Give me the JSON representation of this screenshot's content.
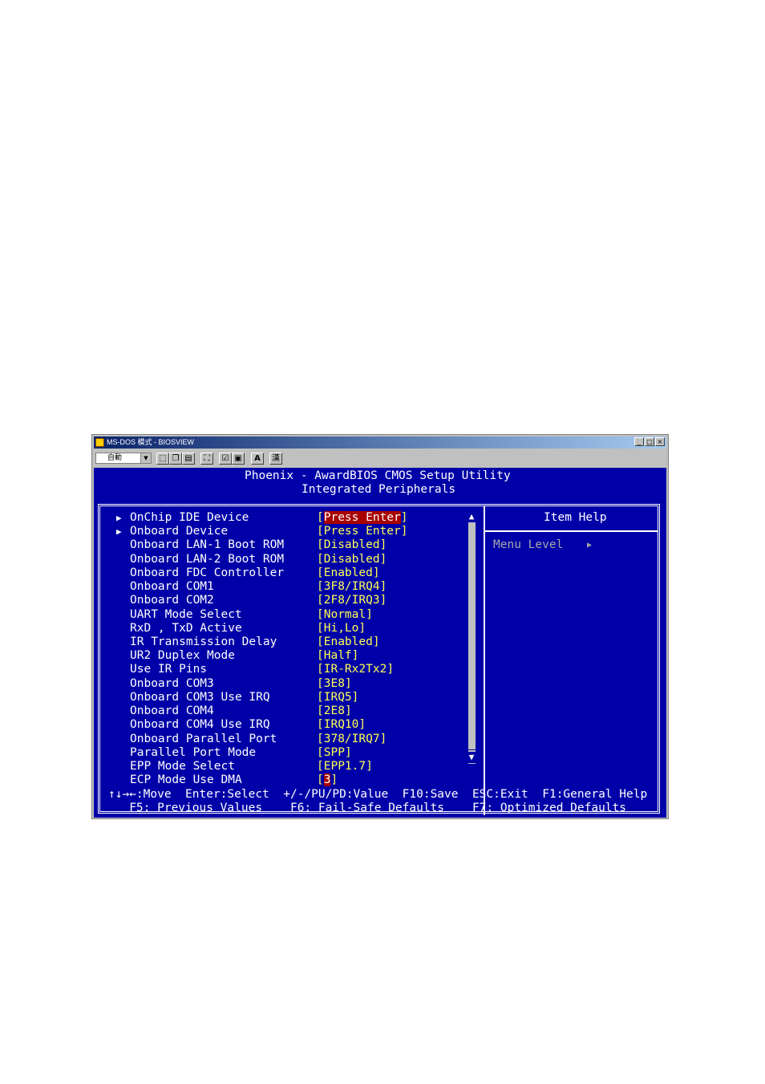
{
  "window": {
    "title": "MS-DOS 模式 - BIOSVIEW",
    "font_select": "自動",
    "controls": [
      "_",
      "□",
      "×"
    ]
  },
  "toolbar_icons": [
    "mark-icon",
    "copy-icon",
    "paste-icon",
    "fullscreen-icon",
    "properties-icon",
    "background-icon",
    "font-icon",
    "ime-icon"
  ],
  "toolbar_glyphs": {
    "font": "A",
    "ime": "漢"
  },
  "header": {
    "line1": "Phoenix - AwardBIOS CMOS Setup Utility",
    "line2": "Integrated Peripherals"
  },
  "items": [
    {
      "label": "OnChip IDE Device",
      "value": "Press Enter",
      "submenu": true,
      "highlight": true
    },
    {
      "label": "Onboard Device",
      "value": "Press Enter",
      "submenu": true
    },
    {
      "label": "Onboard LAN-1 Boot ROM",
      "value": "Disabled"
    },
    {
      "label": "Onboard LAN-2 Boot ROM",
      "value": "Disabled"
    },
    {
      "label": "Onboard FDC Controller",
      "value": "Enabled"
    },
    {
      "label": "Onboard COM1",
      "value": "3F8/IRQ4"
    },
    {
      "label": "Onboard COM2",
      "value": "2F8/IRQ3"
    },
    {
      "label": "UART Mode Select",
      "value": "Normal"
    },
    {
      "label": "RxD , TxD Active",
      "value": "Hi,Lo"
    },
    {
      "label": "IR Transmission Delay",
      "value": "Enabled"
    },
    {
      "label": "UR2 Duplex Mode",
      "value": "Half"
    },
    {
      "label": "Use IR Pins",
      "value": "IR-Rx2Tx2"
    },
    {
      "label": "Onboard COM3",
      "value": "3E8"
    },
    {
      "label": "Onboard COM3 Use IRQ",
      "value": "IRQ5"
    },
    {
      "label": "Onboard COM4",
      "value": "2E8"
    },
    {
      "label": "Onboard COM4 Use IRQ",
      "value": "IRQ10"
    },
    {
      "label": "Onboard Parallel Port",
      "value": "378/IRQ7"
    },
    {
      "label": "Parallel Port Mode",
      "value": "SPP"
    },
    {
      "label": "EPP Mode Select",
      "value": "EPP1.7"
    },
    {
      "label": "ECP Mode Use DMA",
      "value": "3",
      "highlight": true
    }
  ],
  "submenu_glyph": "▶",
  "scroll": {
    "up": "▲",
    "down": "▼"
  },
  "help": {
    "title": "Item Help",
    "menu_level": "Menu Level",
    "menu_level_arrow": "▶"
  },
  "keys": {
    "line1": "↑↓→←:Move  Enter:Select  +/-/PU/PD:Value  F10:Save  ESC:Exit  F1:General Help",
    "line2": "   F5: Previous Values    F6: Fail-Safe Defaults    F7: Optimized Defaults"
  }
}
